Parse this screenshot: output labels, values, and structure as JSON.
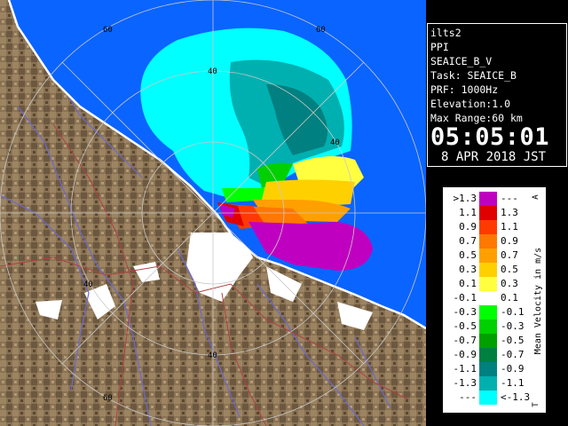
{
  "info": {
    "station": "ilts2",
    "product": "PPI",
    "name": "SEAICE_B_V",
    "task": "Task: SEAICE_B",
    "prf": "PRF: 1000Hz",
    "elevation": "Elevation:1.0",
    "max_range": "Max Range:60 km",
    "time": "05:05:01",
    "date": "8 APR 2018 JST"
  },
  "range_ring_labels": [
    "40",
    "60"
  ],
  "legend": {
    "title": "Mean Velocity in m/s",
    "top_marker": "A",
    "bottom_marker": "T",
    "rows": [
      {
        "left": ">1.3",
        "right": "---",
        "color": "#c000c0"
      },
      {
        "left": "1.1",
        "right": "1.3",
        "color": "#e00000"
      },
      {
        "left": "0.9",
        "right": "1.1",
        "color": "#ff3a00"
      },
      {
        "left": "0.7",
        "right": "0.9",
        "color": "#ff7800"
      },
      {
        "left": "0.5",
        "right": "0.7",
        "color": "#ffa000"
      },
      {
        "left": "0.3",
        "right": "0.5",
        "color": "#ffd000"
      },
      {
        "left": "0.1",
        "right": "0.3",
        "color": "#ffff40"
      },
      {
        "left": "-0.1",
        "right": "0.1",
        "color": "#ffffff"
      },
      {
        "left": "-0.3",
        "right": "-0.1",
        "color": "#00ff00"
      },
      {
        "left": "-0.5",
        "right": "-0.3",
        "color": "#00d000"
      },
      {
        "left": "-0.7",
        "right": "-0.5",
        "color": "#00a000"
      },
      {
        "left": "-0.9",
        "right": "-0.7",
        "color": "#008040"
      },
      {
        "left": "-1.1",
        "right": "-0.9",
        "color": "#008080"
      },
      {
        "left": "-1.3",
        "right": "-1.1",
        "color": "#00b0b0"
      },
      {
        "left": "---",
        "right": "<-1.3",
        "color": "#00ffff"
      }
    ]
  },
  "colors": {
    "sea": "#0a64ff",
    "land": "#8a7354",
    "land_dark": "#5a4630",
    "no_echo_white": "#ffffff",
    "ring": "#c8c8c8",
    "river": "#6a6ad0",
    "boundary": "#b04040",
    "coast": "#ffffff"
  }
}
